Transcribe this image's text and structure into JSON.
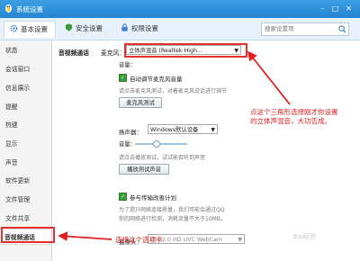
{
  "window": {
    "title": "系统设置"
  },
  "tabs": [
    {
      "label": "基本设置",
      "active": true
    },
    {
      "label": "安全设置",
      "active": false
    },
    {
      "label": "权限设置",
      "active": false
    }
  ],
  "search": {
    "placeholder": "搜索设置项"
  },
  "sidebar": {
    "items": [
      {
        "label": "状态"
      },
      {
        "label": "会话窗口"
      },
      {
        "label": "信息展示"
      },
      {
        "label": "提醒"
      },
      {
        "label": "热键"
      },
      {
        "label": "显示"
      },
      {
        "label": "声音"
      },
      {
        "label": "软件更新"
      },
      {
        "label": "文件管理"
      },
      {
        "label": "文件共享"
      },
      {
        "label": "音视频通话"
      }
    ]
  },
  "av": {
    "section_label": "音视频通话",
    "mic_label": "麦克风：",
    "mic_value": "立体声混音 (Realtek High...",
    "mic_volume_label": "音量：",
    "auto_adjust_label": "自动调节麦克风音量",
    "mic_hint": "请点击麦克风测试，对着麦克风说话进行调节",
    "mic_test_button": "麦克风测试",
    "speaker_label": "扬声器：",
    "speaker_value": "Windows默认设备",
    "speaker_volume_label": "音量：",
    "speaker_hint": "请点击播放测试，试试能否听到声音",
    "speaker_test_button": "播放测试声音",
    "plan_label": "参与传输改善计划",
    "plan_hint_1": "为了提升网络连接质量，我们可能会通过QQ",
    "plan_hint_2": "你的网络进行检测，消耗流量不大于10MB。",
    "camera_label": "摄像头：",
    "camera_value": "USB2.0 HD UVC WebCam"
  },
  "annotations": {
    "right_1": "点这个三角形选择刚才你设置",
    "right_2": "的立体声混音，大功告成。",
    "bottom": "选择这个选项卡"
  },
  "watermark": "Bai经验",
  "colors": {
    "titlebar": "#2585d2",
    "annotation": "#e02020",
    "checkbox": "#3a9d3a"
  }
}
